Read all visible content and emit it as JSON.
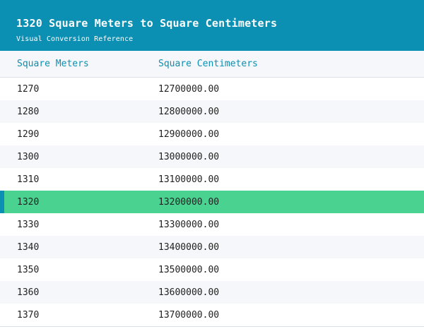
{
  "header": {
    "title": "1320 Square Meters to Square Centimeters",
    "subtitle": "Visual Conversion Reference"
  },
  "columns": [
    "Square Meters",
    "Square Centimeters"
  ],
  "rows": [
    {
      "m2": "1270",
      "cm2": "12700000.00"
    },
    {
      "m2": "1280",
      "cm2": "12800000.00"
    },
    {
      "m2": "1290",
      "cm2": "12900000.00"
    },
    {
      "m2": "1300",
      "cm2": "13000000.00"
    },
    {
      "m2": "1310",
      "cm2": "13100000.00"
    },
    {
      "m2": "1320",
      "cm2": "13200000.00"
    },
    {
      "m2": "1330",
      "cm2": "13300000.00"
    },
    {
      "m2": "1340",
      "cm2": "13400000.00"
    },
    {
      "m2": "1350",
      "cm2": "13500000.00"
    },
    {
      "m2": "1360",
      "cm2": "13600000.00"
    },
    {
      "m2": "1370",
      "cm2": "13700000.00"
    }
  ],
  "highlighted_row": 5,
  "colors": {
    "header_bg": "#0b8fb3",
    "highlight_bg": "#4ad290",
    "stripe_bg": "#f5f7fa",
    "column_header_text": "#0b8fb3"
  }
}
